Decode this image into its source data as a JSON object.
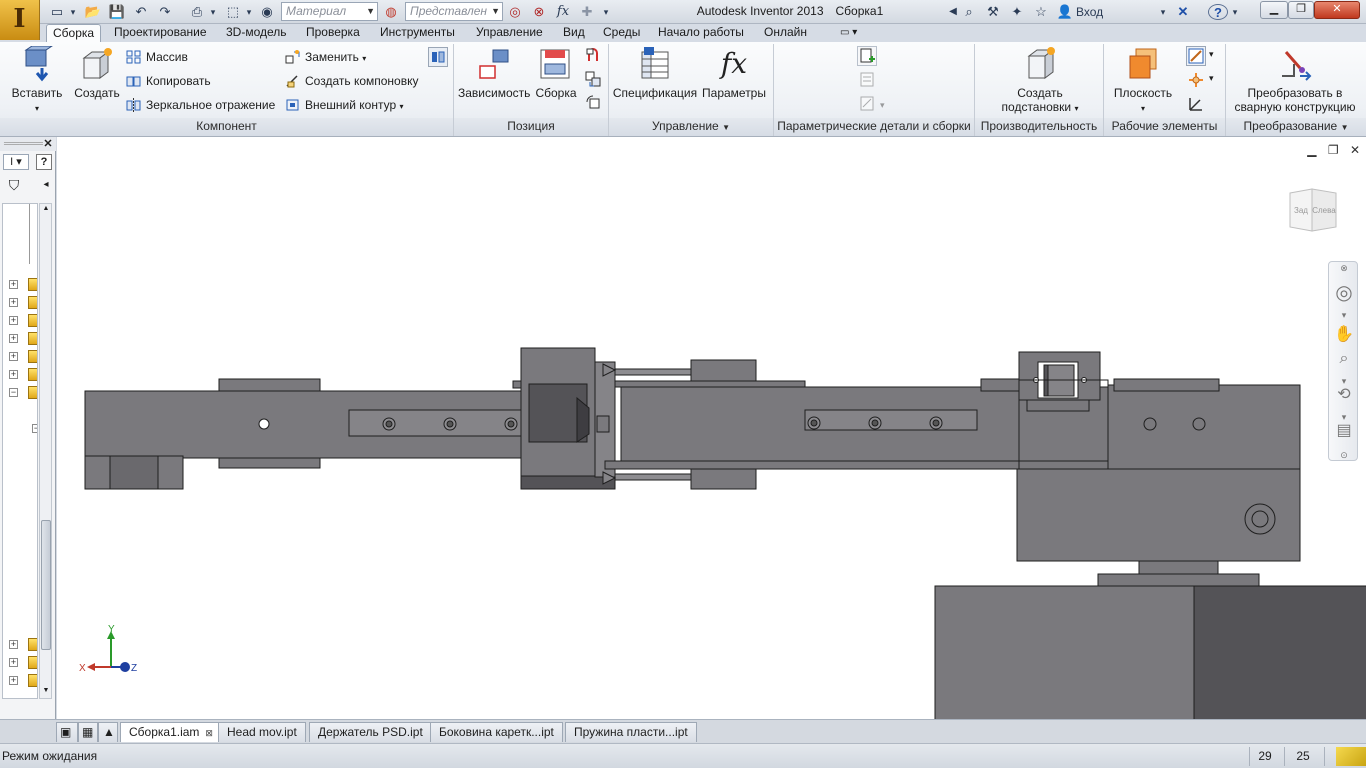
{
  "app": {
    "title": "Autodesk Inventor 2013",
    "document": "Сборка1",
    "logo_letter": "I"
  },
  "quick_access": {
    "material_placeholder": "Материал",
    "representation_placeholder": "Представлен",
    "fx_label": "fx",
    "login_label": "Вход"
  },
  "tabs": [
    {
      "label": "Сборка",
      "active": true
    },
    {
      "label": "Проектирование"
    },
    {
      "label": "3D-модель"
    },
    {
      "label": "Проверка"
    },
    {
      "label": "Инструменты"
    },
    {
      "label": "Управление"
    },
    {
      "label": "Вид"
    },
    {
      "label": "Среды"
    },
    {
      "label": "Начало работы"
    },
    {
      "label": "Онлайн"
    }
  ],
  "ribbon": {
    "component": {
      "panel_label": "Компонент",
      "insert": "Вставить",
      "create": "Создать",
      "pattern": "Массив",
      "copy": "Копировать",
      "mirror": "Зеркальное отражение",
      "replace": "Заменить",
      "create_layout": "Создать компоновку",
      "shrinkwrap": "Внешний контур"
    },
    "position": {
      "panel_label": "Позиция",
      "constrain": "Зависимость",
      "assemble": "Сборка"
    },
    "manage": {
      "panel_label": "Управление",
      "bom": "Спецификация",
      "parameters": "Параметры",
      "fx_symbol": "fx"
    },
    "parametric": {
      "panel_label": "Параметрические детали и сборки"
    },
    "productivity": {
      "panel_label": "Производительность",
      "create_substitute_line1": "Создать",
      "create_substitute_line2": "подстановки"
    },
    "work_features": {
      "panel_label": "Рабочие элементы",
      "plane": "Плоскость"
    },
    "convert": {
      "panel_label": "Преобразование",
      "convert_line1": "Преобразовать в",
      "convert_line2": "сварную конструкцию"
    }
  },
  "viewcube": {
    "face_back": "Зад",
    "face_left": "Слева"
  },
  "triad": {
    "x": "X",
    "y": "Y",
    "z": "Z"
  },
  "doc_tabs": [
    {
      "label": "Сборка1.iam",
      "active": true
    },
    {
      "label": "Head mov.ipt"
    },
    {
      "label": "Держатель PSD.ipt"
    },
    {
      "label": "Боковина каретк...ipt"
    },
    {
      "label": "Пружина пласти...ipt"
    }
  ],
  "status": {
    "text": "Режим ожидания",
    "count_a": "29",
    "count_b": "25"
  },
  "colors": {
    "accent": "#2a62b8",
    "model_body": "#7a797d",
    "model_dark": "#545357",
    "model_edge": "#1e1e1e"
  }
}
